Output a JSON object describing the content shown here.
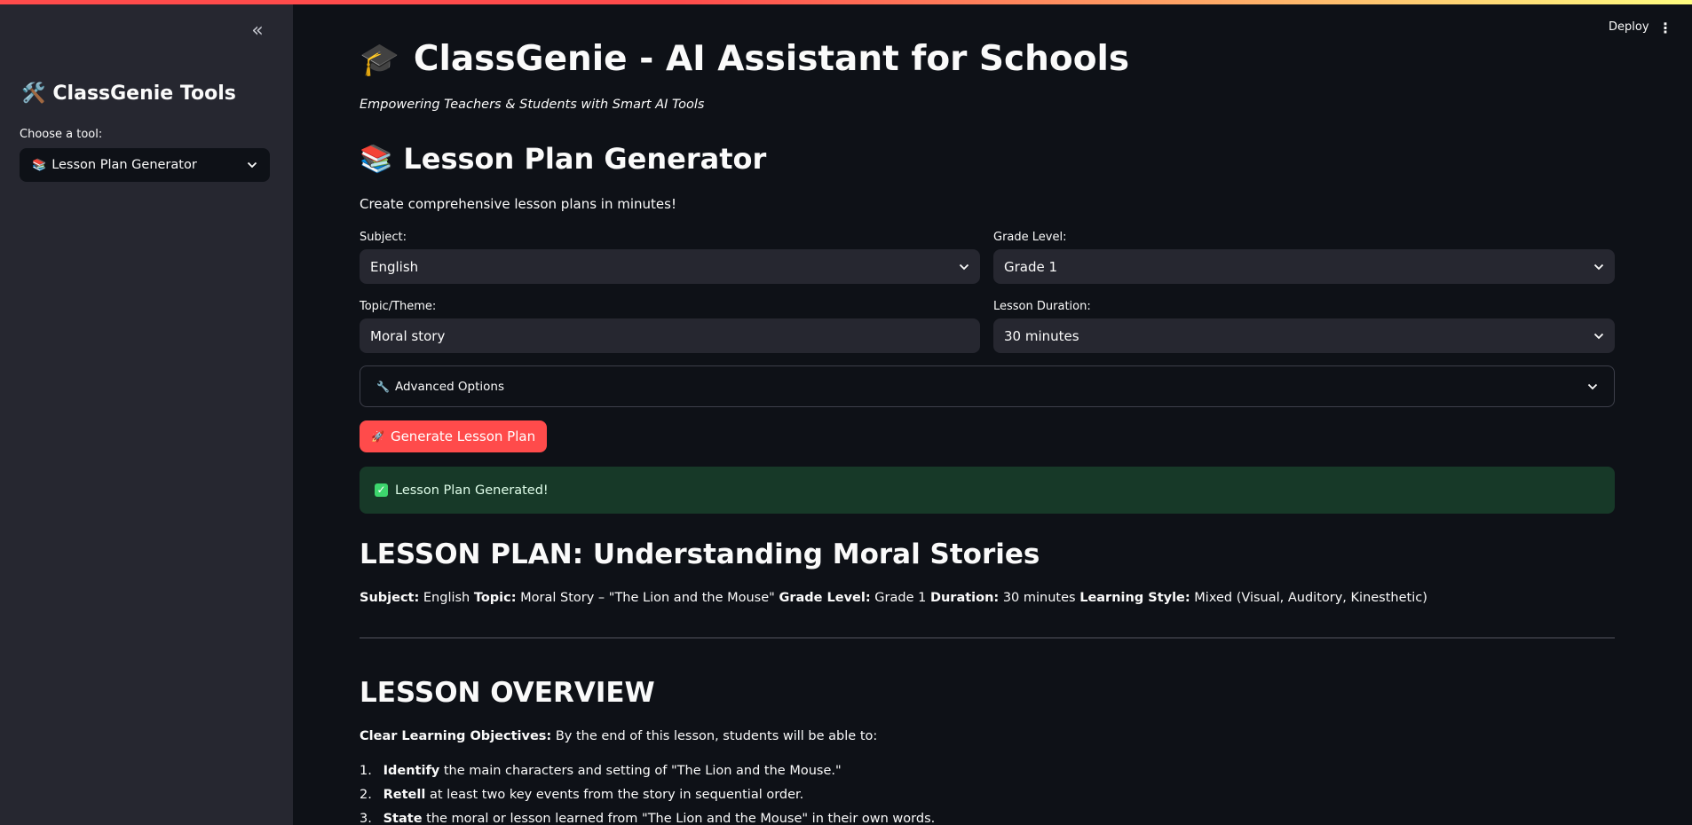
{
  "sidebar": {
    "collapse_icon": "double-chevron-left-icon",
    "title_icon": "tools-icon",
    "title": "ClassGenie Tools",
    "tool_label": "Choose a tool:",
    "tool_icon": "books-icon",
    "tool_selected": "Lesson Plan Generator"
  },
  "header": {
    "deploy_label": "Deploy",
    "menu_icon": "kebab-menu-icon"
  },
  "app": {
    "title_icon": "graduation-cap-icon",
    "title": "ClassGenie - AI Assistant for Schools",
    "tagline": "Empowering Teachers & Students with Smart AI Tools"
  },
  "generator": {
    "icon": "books-icon",
    "title": "Lesson Plan Generator",
    "description": "Create comprehensive lesson plans in minutes!",
    "subject_label": "Subject:",
    "subject_value": "English",
    "grade_label": "Grade Level:",
    "grade_value": "Grade 1",
    "topic_label": "Topic/Theme:",
    "topic_value": "Moral story",
    "duration_label": "Lesson Duration:",
    "duration_value": "30 minutes",
    "advanced_label": "Advanced Options",
    "generate_label": "Generate Lesson Plan",
    "success_text": "Lesson Plan Generated!"
  },
  "plan": {
    "title": "LESSON PLAN: Understanding Moral Stories",
    "meta": {
      "subject_key": "Subject:",
      "subject_val": "English",
      "topic_key": "Topic:",
      "topic_val": "Moral Story – \"The Lion and the Mouse\"",
      "grade_key": "Grade Level:",
      "grade_val": "Grade 1",
      "duration_key": "Duration:",
      "duration_val": "30 minutes",
      "style_key": "Learning Style:",
      "style_val": "Mixed (Visual, Auditory, Kinesthetic)"
    },
    "overview_title": "LESSON OVERVIEW",
    "objectives_key": "Clear Learning Objectives:",
    "objectives_text": "By the end of this lesson, students will be able to:",
    "objectives": [
      {
        "num": "1.",
        "verb": "Identify",
        "text": "the main characters and setting of \"The Lion and the Mouse.\""
      },
      {
        "num": "2.",
        "verb": "Retell",
        "text": "at least two key events from the story in sequential order."
      },
      {
        "num": "3.",
        "verb": "State",
        "text": "the moral or lesson learned from \"The Lion and the Mouse\" in their own words."
      }
    ]
  },
  "colors": {
    "background": "#0e1117",
    "sidebar": "#262730",
    "primary_button": "#ff4b4b",
    "success_bg": "#173928"
  }
}
